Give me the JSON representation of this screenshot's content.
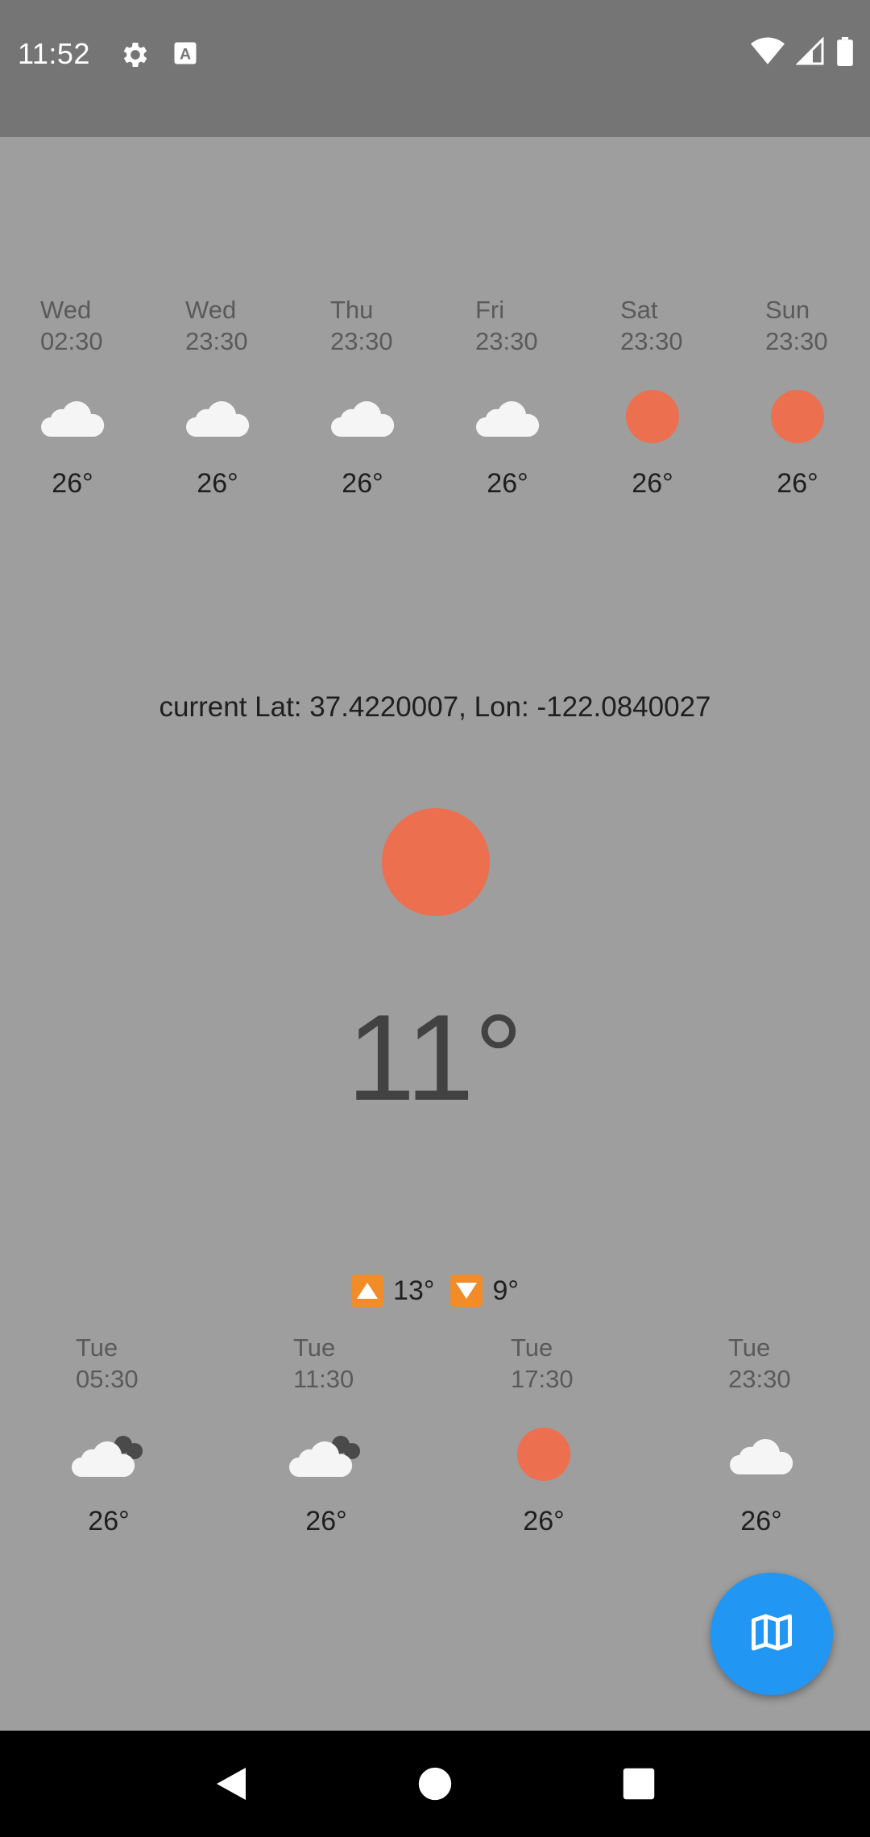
{
  "status_bar": {
    "time": "11:52",
    "icons": [
      "gear-icon",
      "a-letter-icon",
      "wifi-icon",
      "signal-icon",
      "battery-icon"
    ]
  },
  "daily_forecast": [
    {
      "day": "Wed",
      "time": "02:30",
      "icon": "cloud-icon",
      "temp": "26°"
    },
    {
      "day": "Wed",
      "time": "23:30",
      "icon": "cloud-icon",
      "temp": "26°"
    },
    {
      "day": "Thu",
      "time": "23:30",
      "icon": "cloud-icon",
      "temp": "26°"
    },
    {
      "day": "Fri",
      "time": "23:30",
      "icon": "cloud-icon",
      "temp": "26°"
    },
    {
      "day": "Sat",
      "time": "23:30",
      "icon": "sun-icon",
      "temp": "26°"
    },
    {
      "day": "Sun",
      "time": "23:30",
      "icon": "sun-icon",
      "temp": "26°"
    }
  ],
  "location": {
    "text": "current Lat: 37.4220007, Lon: -122.0840027"
  },
  "current": {
    "icon": "sun-icon",
    "temp": "11°",
    "max": "13°",
    "min": "9°"
  },
  "hourly_forecast": [
    {
      "day": "Tue",
      "time": "05:30",
      "icon": "partly-cloudy-icon",
      "temp": "26°"
    },
    {
      "day": "Tue",
      "time": "11:30",
      "icon": "partly-cloudy-icon",
      "temp": "26°"
    },
    {
      "day": "Tue",
      "time": "17:30",
      "icon": "sun-icon",
      "temp": "26°"
    },
    {
      "day": "Tue",
      "time": "23:30",
      "icon": "cloud-icon",
      "temp": "26°"
    }
  ],
  "fab": {
    "icon": "map-icon",
    "color": "#2196f3"
  },
  "colors": {
    "sun": "#ec6f4f",
    "background": "#9e9e9e",
    "status_bar": "#757575"
  }
}
